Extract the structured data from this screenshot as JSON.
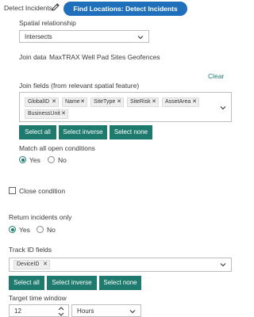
{
  "header": {
    "title": "Detect Incidents",
    "find_button": "Find Locations: Detect Incidents"
  },
  "spatial": {
    "label": "Spatial relationship",
    "value": "Intersects"
  },
  "join": {
    "label": "Join data",
    "value": "MaxTRAX Well Pad Sites Geofences",
    "clear": "Clear",
    "fields_label": "Join fields (from relevant spatial feature)",
    "tags": [
      "GlobalID",
      "Name",
      "SiteType",
      "SiteRisk",
      "AssetArea",
      "BusinessUnit"
    ],
    "select_all": "Select all",
    "select_inverse": "Select inverse",
    "select_none": "Select none"
  },
  "match": {
    "label": "Match all open conditions",
    "yes": "Yes",
    "no": "No",
    "selected": "Yes"
  },
  "close_condition": {
    "label": "Close condition",
    "checked": false
  },
  "return_incidents": {
    "label": "Return incidents only",
    "yes": "Yes",
    "no": "No",
    "selected": "Yes"
  },
  "track_id": {
    "label": "Track ID fields",
    "tags": [
      "DeviceID"
    ],
    "select_all": "Select all",
    "select_inverse": "Select inverse",
    "select_none": "Select none"
  },
  "time_window": {
    "label": "Target time window",
    "value": "12",
    "unit": "Hours"
  },
  "colors": {
    "primary_blue": "#1f6fbb",
    "teal": "#1f7a6e",
    "border": "#bdbdbd"
  }
}
